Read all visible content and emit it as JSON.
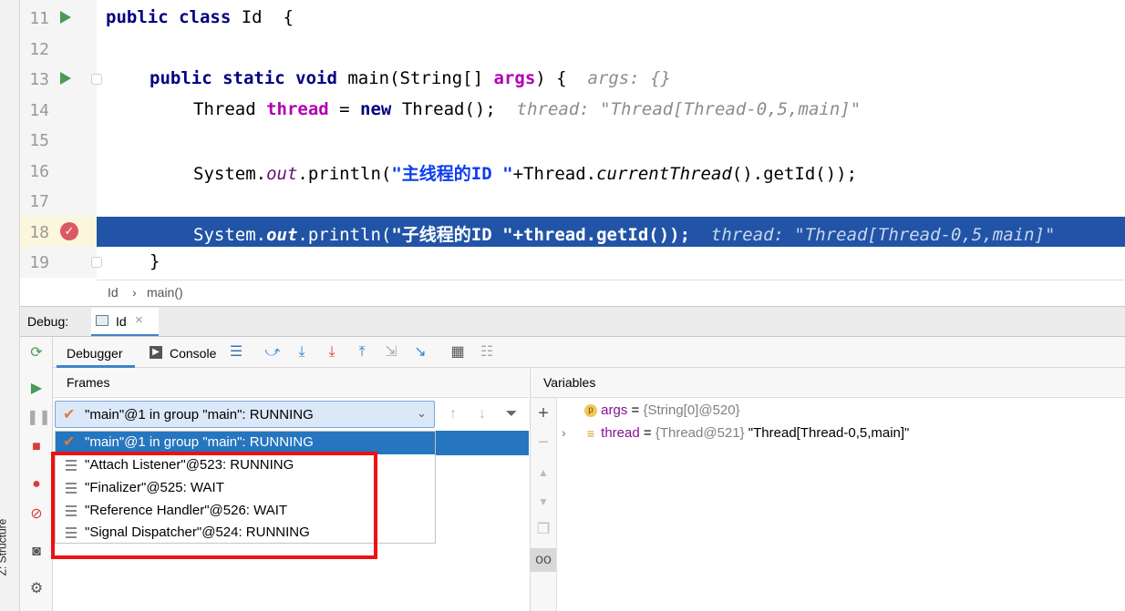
{
  "left_strip": {
    "structure_label": "Z: Structure"
  },
  "editor": {
    "lines": [
      {
        "num": "11"
      },
      {
        "num": "12"
      },
      {
        "num": "13"
      },
      {
        "num": "14"
      },
      {
        "num": "15"
      },
      {
        "num": "16"
      },
      {
        "num": "17"
      },
      {
        "num": "18"
      },
      {
        "num": "19"
      }
    ],
    "code": {
      "l11_kw": "public class",
      "l11_rest": " Id  {",
      "l13_kw": "public static void",
      "l13_rest1": " main(String[] ",
      "l13_args": "args",
      "l13_rest2": ") {  ",
      "l13_hint": "args: {}",
      "l14_type": "Thread ",
      "l14_var": "thread",
      "l14_eq": " = ",
      "l14_new": "new",
      "l14_rest": " Thread();  ",
      "l14_hint": "thread: \"Thread[Thread-0,5,main]\"",
      "l16_a": "System.",
      "l16_out": "out",
      "l16_b": ".println(",
      "l16_str": "\"主线程的ID \"",
      "l16_c": "+Thread.",
      "l16_cur": "currentThread",
      "l16_d": "().getId());",
      "l18_a": "System.",
      "l18_out": "out",
      "l18_b": ".println(",
      "l18_str": "\"子线程的ID \"",
      "l18_c": "+thread.getId());  ",
      "l18_hint": "thread: \"Thread[Thread-0,5,main]\"",
      "l19": "}"
    },
    "breakpoint_icon": "breakpoint-check-icon",
    "run_icon": "run-triangle-icon"
  },
  "breadcrumb": {
    "class": "Id",
    "sep": "›",
    "method": "main()"
  },
  "debug_bar": {
    "label": "Debug:",
    "tab": "Id",
    "close": "×"
  },
  "toolbar": {
    "debugger_tab": "Debugger",
    "console_tab": "Console"
  },
  "frames": {
    "header": "Frames",
    "selected_thread": "\"main\"@1 in group \"main\": RUNNING",
    "dropdown_items": [
      {
        "label": "\"main\"@1 in group \"main\": RUNNING",
        "selected": true
      },
      {
        "label": "\"Attach Listener\"@523: RUNNING"
      },
      {
        "label": "\"Finalizer\"@525: WAIT"
      },
      {
        "label": "\"Reference Handler\"@526: WAIT"
      },
      {
        "label": "\"Signal Dispatcher\"@524: RUNNING"
      }
    ]
  },
  "variables": {
    "header": "Variables",
    "items": [
      {
        "badge": "p",
        "name": "args",
        "eq": " = ",
        "ref": "{String[0]@520}",
        "value": ""
      },
      {
        "badge": "≡",
        "name": "thread",
        "eq": " = ",
        "ref": "{Thread@521}",
        "value": " \"Thread[Thread-0,5,main]\""
      }
    ]
  },
  "colors": {
    "highlight": "#2154a6",
    "selection": "#2675bf",
    "annotation_box": "#ee1111"
  }
}
